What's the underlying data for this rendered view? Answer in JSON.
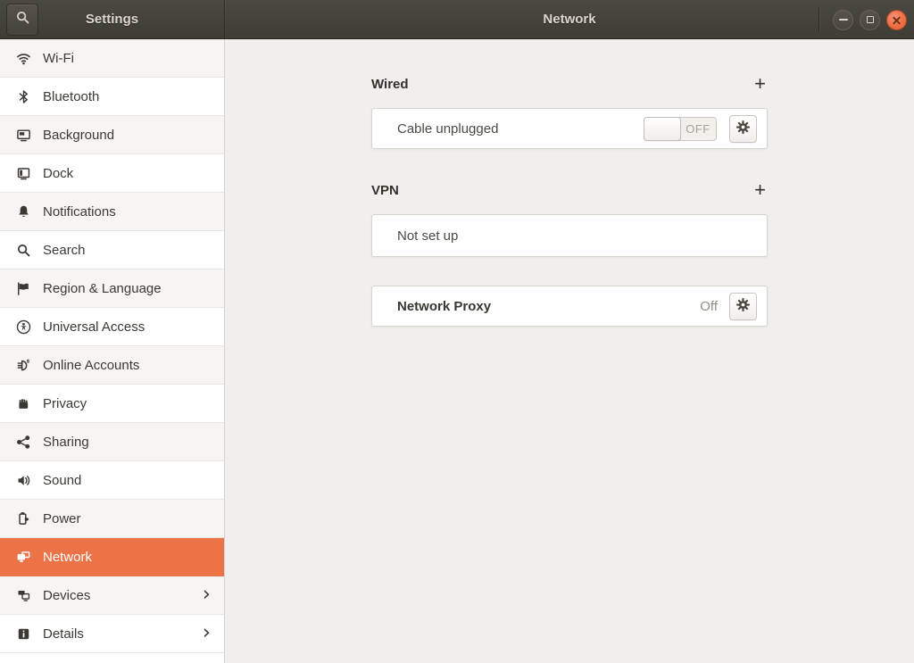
{
  "titlebar": {
    "left": {
      "title": "Settings",
      "search_icon": "search-icon"
    },
    "right": {
      "title": "Network",
      "window_controls": [
        "minimize",
        "maximize",
        "close"
      ]
    }
  },
  "sidebar": {
    "items": [
      {
        "label": "Wi-Fi",
        "icon": "wifi-icon"
      },
      {
        "label": "Bluetooth",
        "icon": "bluetooth-icon"
      },
      {
        "label": "Background",
        "icon": "background-icon"
      },
      {
        "label": "Dock",
        "icon": "dock-icon"
      },
      {
        "label": "Notifications",
        "icon": "bell-icon"
      },
      {
        "label": "Search",
        "icon": "search-icon"
      },
      {
        "label": "Region & Language",
        "icon": "flag-icon"
      },
      {
        "label": "Universal Access",
        "icon": "universal-access-icon"
      },
      {
        "label": "Online Accounts",
        "icon": "online-accounts-icon"
      },
      {
        "label": "Privacy",
        "icon": "hand-icon"
      },
      {
        "label": "Sharing",
        "icon": "share-icon"
      },
      {
        "label": "Sound",
        "icon": "speaker-icon"
      },
      {
        "label": "Power",
        "icon": "battery-icon"
      },
      {
        "label": "Network",
        "icon": "network-icon",
        "selected": true
      },
      {
        "label": "Devices",
        "icon": "devices-icon",
        "chevron": true
      },
      {
        "label": "Details",
        "icon": "info-icon",
        "chevron": true
      }
    ]
  },
  "content": {
    "wired": {
      "title": "Wired",
      "add_label": "+",
      "device_label": "Cable unplugged",
      "toggle": {
        "state": "off",
        "label": "OFF"
      },
      "gear_icon": "gear-icon"
    },
    "vpn": {
      "title": "VPN",
      "add_label": "+",
      "row_label": "Not set up"
    },
    "proxy": {
      "title": "Network Proxy",
      "status": "Off",
      "gear_icon": "gear-icon"
    }
  },
  "colors": {
    "accent": "#EC7348",
    "close_button": "#ED6B3C",
    "header_bg": "#45423C",
    "content_bg": "#F1EFED"
  }
}
